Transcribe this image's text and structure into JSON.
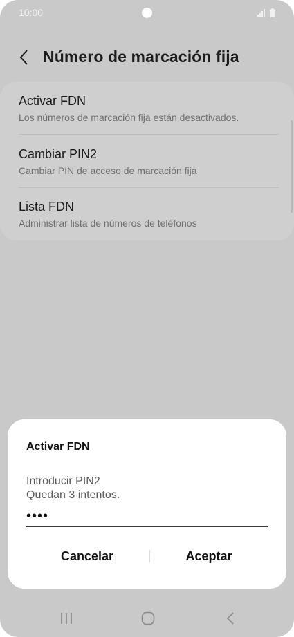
{
  "status_bar": {
    "time": "10:00"
  },
  "header": {
    "title": "Número de marcación fija"
  },
  "list": {
    "items": [
      {
        "title": "Activar FDN",
        "subtitle": "Los números de marcación fija están desactivados."
      },
      {
        "title": "Cambiar PIN2",
        "subtitle": "Cambiar PIN de acceso de marcación fija"
      },
      {
        "title": "Lista FDN",
        "subtitle": "Administrar lista de números de teléfonos"
      }
    ]
  },
  "dialog": {
    "title": "Activar FDN",
    "prompt_line1": "Introducir PIN2",
    "prompt_line2": "Quedan 3 intentos.",
    "pin_value": "••••",
    "cancel_label": "Cancelar",
    "accept_label": "Aceptar"
  },
  "nav_bar": {
    "icons": [
      "recent-apps-icon",
      "home-icon",
      "back-icon"
    ]
  },
  "colors": {
    "background_dim": "#c9c9c9",
    "dialog_bg": "#ffffff",
    "text": "#111111"
  }
}
